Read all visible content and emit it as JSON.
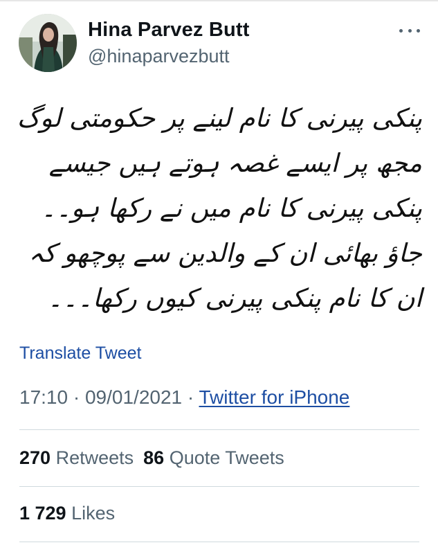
{
  "author": {
    "display_name": "Hina Parvez Butt",
    "handle": "@hinaparvezbutt"
  },
  "icons": {
    "avatar": "profile-photo",
    "more": "more-options-icon"
  },
  "tweet": {
    "text": "پنکی پیرنی کا نام لینے پر حکومتی لوگ مجھ پر ایسے غصہ ہوتے ہیں جیسے پنکی پیرنی کا نام میں نے رکھا ہو۔۔جاؤ بھائی ان کے والدین سے پوچھو کہ ان کا نام پنکی پیرنی کیوں رکھا۔۔۔",
    "translate_label": "Translate Tweet",
    "time": "17:10",
    "separator": "·",
    "date": "09/01/2021",
    "source": "Twitter for iPhone"
  },
  "stats": {
    "retweets_count": "270",
    "retweets_label": "Retweets",
    "quotes_count": "86",
    "quotes_label": "Quote Tweets",
    "likes_count": "1 729",
    "likes_label": "Likes"
  },
  "colors": {
    "link": "#1d4ea3",
    "secondary_text": "#536471",
    "divider": "#cfd9de"
  }
}
